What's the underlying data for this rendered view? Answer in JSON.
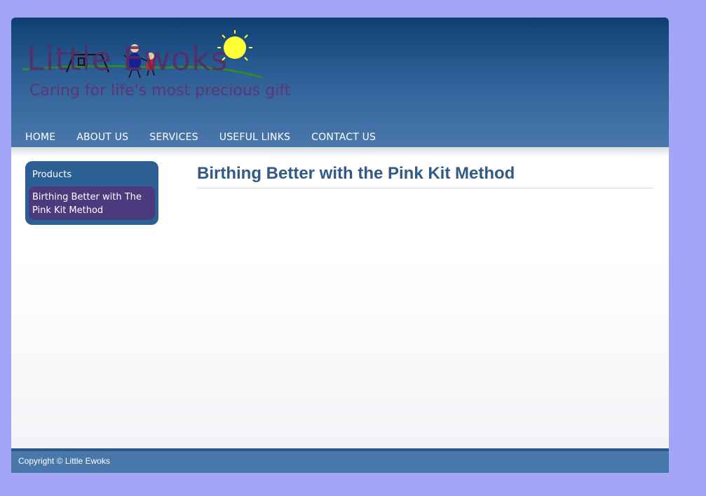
{
  "header": {
    "logo_text": "Little Ewoks",
    "tagline": "Caring for life's most precious gift"
  },
  "nav": {
    "items": [
      {
        "label": "HOME"
      },
      {
        "label": "ABOUT US"
      },
      {
        "label": "SERVICES"
      },
      {
        "label": "USEFUL LINKS"
      },
      {
        "label": "CONTACT US"
      }
    ]
  },
  "sidebar": {
    "heading": "Products",
    "items": [
      {
        "label": "Birthing Better with The Pink Kit Method"
      }
    ]
  },
  "main": {
    "title": "Birthing Better with the Pink Kit Method"
  },
  "footer": {
    "copyright": "Copyright © Little Ewoks"
  },
  "colors": {
    "page_background": "#a3a5f7",
    "header_dark": "#0f3f72",
    "header_light": "#4a78ad",
    "sidebar": "#2c5f93",
    "sidebar_active": "#4b3b7e",
    "title": "#315b86"
  }
}
